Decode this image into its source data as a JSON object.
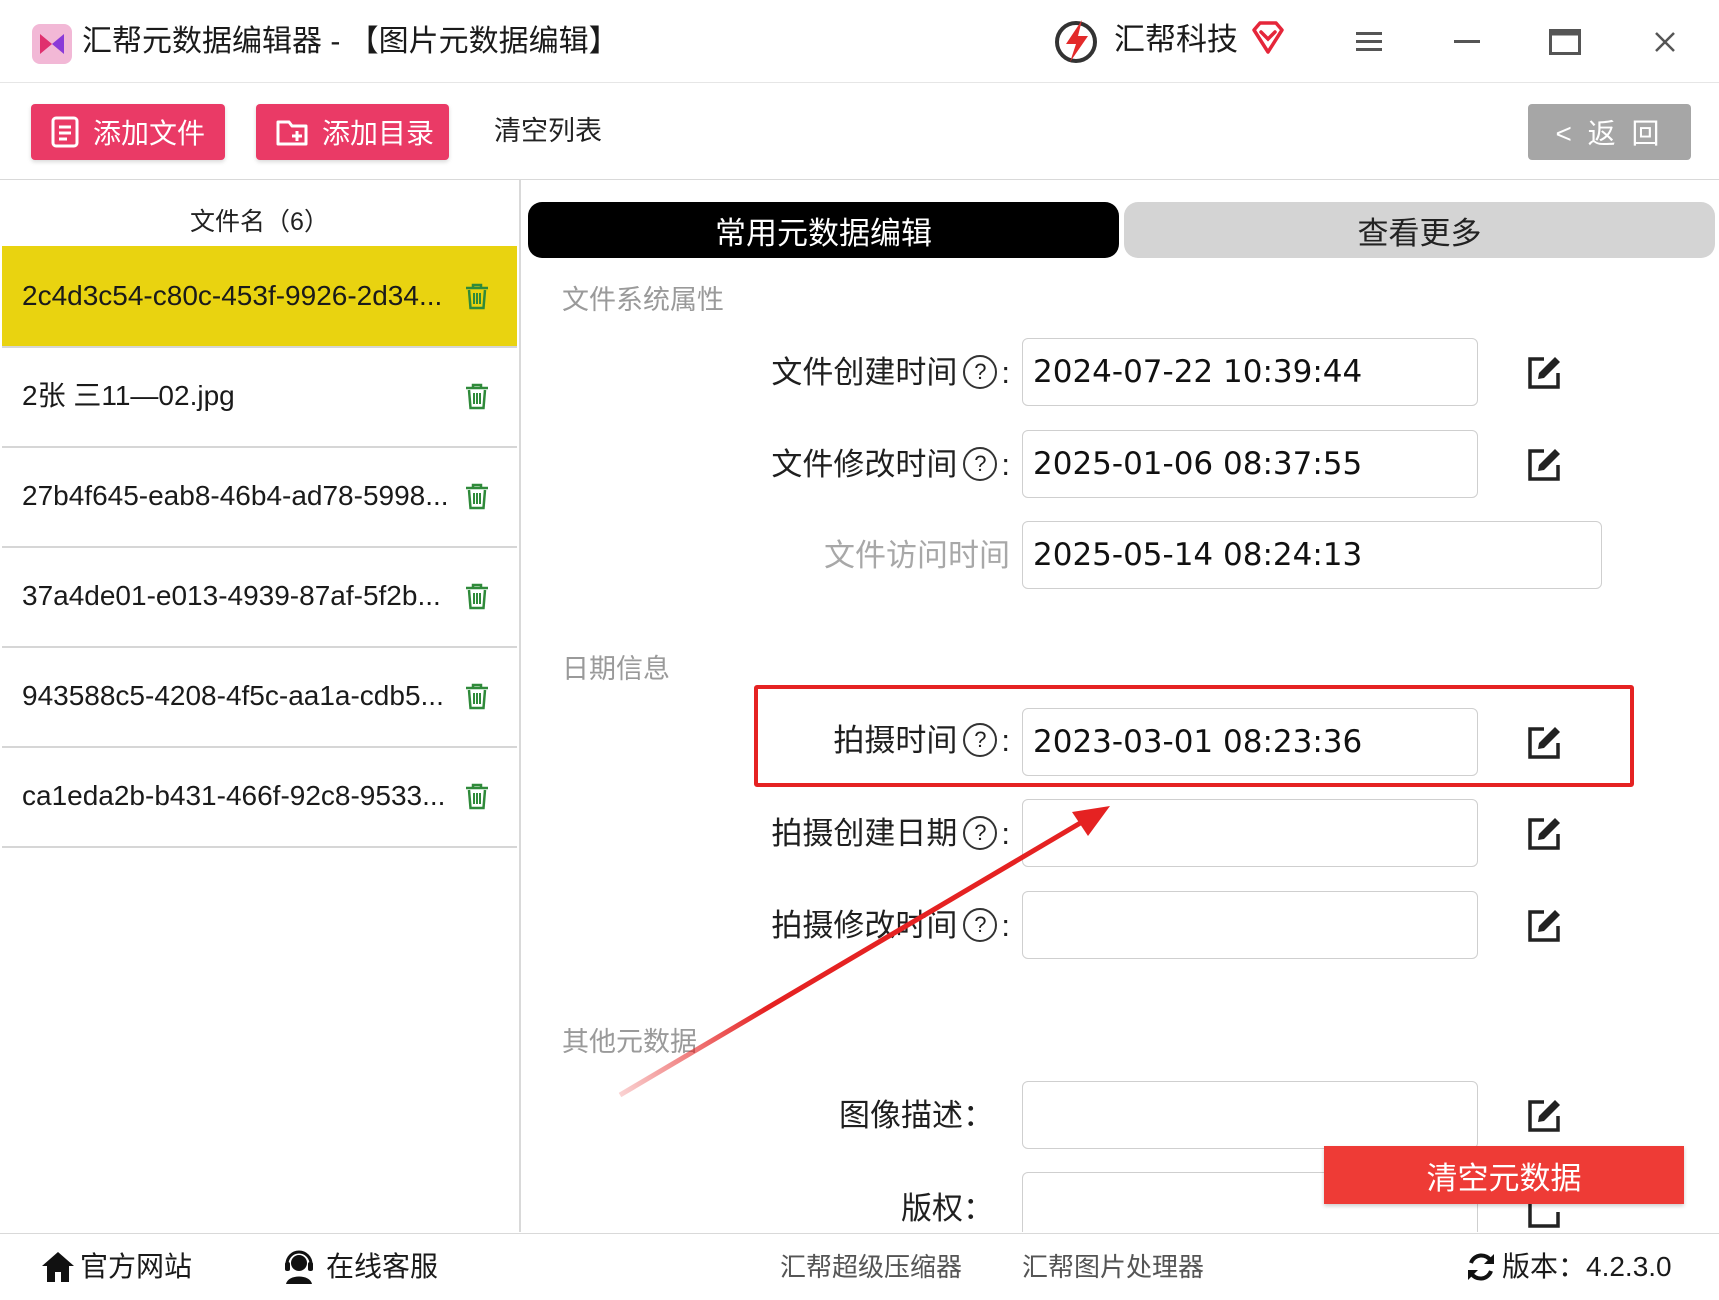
{
  "window": {
    "title": "汇帮元数据编辑器 - 【图片元数据编辑】",
    "brand": "汇帮科技"
  },
  "toolbar": {
    "add_file": "添加文件",
    "add_dir": "添加目录",
    "clear_list": "清空列表",
    "back": "< 返 回"
  },
  "file_list": {
    "header": "文件名（6）",
    "items": [
      {
        "name": "2c4d3c54-c80c-453f-9926-2d34...",
        "selected": true
      },
      {
        "name": "2张 三11—02.jpg",
        "selected": false
      },
      {
        "name": "27b4f645-eab8-46b4-ad78-5998...",
        "selected": false
      },
      {
        "name": "37a4de01-e013-4939-87af-5f2b...",
        "selected": false
      },
      {
        "name": "943588c5-4208-4f5c-aa1a-cdb5...",
        "selected": false
      },
      {
        "name": "ca1eda2b-b431-466f-92c8-9533...",
        "selected": false
      }
    ]
  },
  "tabs": {
    "common": "常用元数据编辑",
    "more": "查看更多"
  },
  "sections": {
    "fs": {
      "title": "文件系统属性",
      "create_label": "文件创建时间",
      "create_value": "2024-07-22 10:39:44",
      "modify_label": "文件修改时间",
      "modify_value": "2025-01-06 08:37:55",
      "access_label": "文件访问时间",
      "access_value": "2025-05-14 08:24:13"
    },
    "date": {
      "title": "日期信息",
      "shot_label": "拍摄时间",
      "shot_value": "2023-03-01 08:23:36",
      "shot_create_label": "拍摄创建日期",
      "shot_create_value": "",
      "shot_modify_label": "拍摄修改时间",
      "shot_modify_value": ""
    },
    "other": {
      "title": "其他元数据",
      "desc_label": "图像描述：",
      "desc_value": "",
      "copyright_label": "版权：",
      "copyright_value": ""
    }
  },
  "help_glyph": "?",
  "colon": ":",
  "clear_meta": "清空元数据",
  "footer": {
    "website": "官方网站",
    "support": "在线客服",
    "compressor": "汇帮超级压缩器",
    "image_tool": "汇帮图片处理器",
    "version": "版本：4.2.3.0"
  },
  "colors": {
    "accent_pink": "#ea3a66",
    "selected_row": "#e9d310",
    "highlight_red": "#e52222",
    "clear_red": "#ee3b36"
  }
}
